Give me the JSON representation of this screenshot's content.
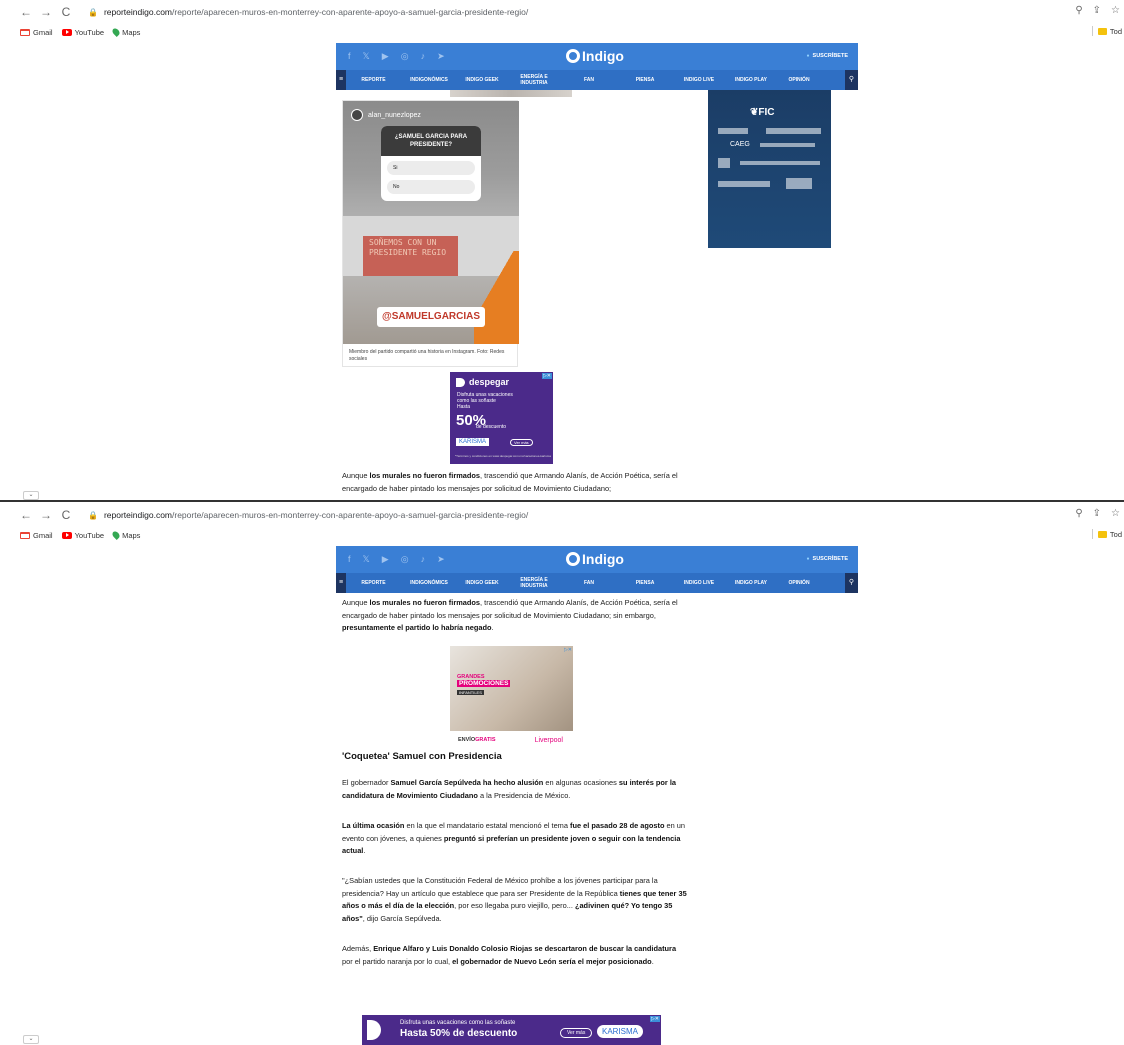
{
  "browser": {
    "nav_back": "←",
    "nav_forward": "→",
    "nav_reload": "C",
    "lock": "🔒",
    "url_domain": "reporteindigo.com",
    "url_path": "/reporte/aparecen-muros-en-monterrey-con-aparente-apoyo-a-samuel-garcia-presidente-regio/",
    "icons_right": [
      "zoom-icon",
      "share-icon",
      "star-icon"
    ],
    "bookmarks": [
      {
        "label": "Gmail",
        "icon": "gmail-icon"
      },
      {
        "label": "YouTube",
        "icon": "youtube-icon"
      },
      {
        "label": "Maps",
        "icon": "maps-icon"
      }
    ],
    "bookmark_folder": "Tod"
  },
  "site": {
    "logo": "Indigo",
    "subscribe": "SUSCRÍBETE",
    "socials": [
      "f",
      "𝕏",
      "▶",
      "◎",
      "♪",
      "➤"
    ],
    "menu_icon": "≡",
    "search_icon": "⚲",
    "nav": [
      "REPORTE",
      "INDIGONÓMICS",
      "INDIGO GEEK",
      "ENERGÍA E INDUSTRIA",
      "FAN",
      "PIENSA",
      "INDIGO LIVE",
      "INDIGO PLAY",
      "OPINIÓN"
    ]
  },
  "colors": {
    "header_blue": "#3a7fd5",
    "nav_blue": "#2f6fc4",
    "dark_navy": "#1d3461",
    "accent_red": "#c0392b"
  },
  "shot1": {
    "ig_card": {
      "username": "alan_nunezlopez",
      "poll_question": "¿SAMUEL GARCIA PARA PRESIDENTE?",
      "poll_options": [
        "Si",
        "No"
      ],
      "graffiti": "SOÑEMOS CON UN PRESIDENTE REGIO",
      "mention": "@SAMUELGARCIAS",
      "caption": "Miembro del partido compartió una historia en Instagram. Foto: Redes sociales"
    },
    "fic_ad": {
      "logo": "FIC",
      "line_caeg": "CAEG"
    },
    "despegar_ad": {
      "brand": "despegar",
      "text": "Disfruta unas vacaciones como las soñaste",
      "hasta": "Hasta",
      "percent": "50%",
      "descuento": "de descuento",
      "karisma": "KARISMA",
      "ver_mas": "Ver más",
      "foot": "*Términos y condiciones en www.despegar.com.mx/vacaciones-karisma",
      "close": "▷✕"
    },
    "para_cut": {
      "t1": "Aunque ",
      "b1": "los murales no fueron firmados",
      "t2": ", trascendió que Armando Alanís, de Acción Poética, sería el encargado de haber pintado los mensajes por solicitud de Movimiento Ciudadano;"
    },
    "scroll": "⌄"
  },
  "shot2": {
    "p1": {
      "t1": "Aunque ",
      "b1": "los murales no fueron firmados",
      "t2": ", trascendió que Armando Alanís, de Acción Poética, sería el encargado de haber pintado los mensajes por solicitud de Movimiento Ciudadano; sin embargo, ",
      "b2": "presuntamente el partido lo habría negado",
      "t3": "."
    },
    "liverpool_ad": {
      "grandes": "GRANDES",
      "promociones": "PROMOCIONES",
      "infantiles": "INFANTILES",
      "envio": "ENVÍO",
      "gratis": "GRATIS",
      "brand": "Liverpool",
      "close": "▷✕"
    },
    "heading": "'Coquetea' Samuel con Presidencia",
    "p2": {
      "t1": "El gobernador ",
      "b1": "Samuel García Sepúlveda ha hecho alusión",
      "t2": " en algunas ocasiones ",
      "b2": "su interés por la candidatura de Movimiento Ciudadano",
      "t3": " a la Presidencia de México."
    },
    "p3": {
      "b1": "La última ocasión",
      "t1": " en la que el mandatario estatal mencionó el tema ",
      "b2": "fue el pasado 28 de agosto",
      "t2": " en un evento con jóvenes, a quienes ",
      "b3": "preguntó si preferían un presidente joven o seguir con la tendencia actual",
      "t3": "."
    },
    "p4": {
      "t1": "\"¿Sabían ustedes que la Constitución Federal de México prohíbe a los jóvenes participar para la presidencia? Hay un artículo que establece que para ser Presidente de la República ",
      "b1": "tienes que tener 35 años o más el día de la elección",
      "t2": ", por eso llegaba puro viejillo, pero... ",
      "b2": "¿adivinen qué? Yo tengo 35 años\"",
      "t3": ", dijo García Sepúlveda."
    },
    "p5": {
      "t1": "Además, ",
      "b1": "Enrique Alfaro y Luis Donaldo Colosio Riojas se descartaron de buscar la candidatura",
      "t2": " por el partido naranja por lo cual, ",
      "b2": "el gobernador de Nuevo León sería el mejor posicionado",
      "t3": "."
    },
    "banner_ad": {
      "l1": "Disfruta unas vacaciones como las soñaste",
      "l2": "Hasta 50% de descuento",
      "btn": "Ver más",
      "karisma": "KARISMA",
      "close": "▷✕"
    },
    "scroll": "⌄"
  }
}
